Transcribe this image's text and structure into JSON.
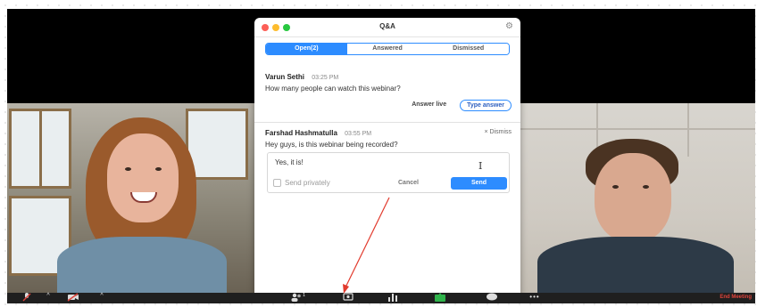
{
  "qa_window": {
    "title": "Q&A",
    "tabs": [
      {
        "label": "Open(2)",
        "active": true
      },
      {
        "label": "Answered",
        "active": false
      },
      {
        "label": "Dismissed",
        "active": false
      }
    ],
    "questions": [
      {
        "name": "Varun Sethi",
        "time": "03:25 PM",
        "text": "How many people can watch this webinar?",
        "answer_live_label": "Answer live",
        "type_answer_label": "Type answer"
      },
      {
        "name": "Farshad Hashmatulla",
        "time": "03:55 PM",
        "text": "Hey guys, is this webinar being recorded?",
        "dismiss_label": "× Dismiss",
        "reply_text": "Yes, it is!",
        "send_privately_label": "Send privately",
        "cancel_label": "Cancel",
        "send_label": "Send"
      }
    ]
  },
  "toolbar": {
    "participants_count": "1",
    "end_label": "End Meeting"
  },
  "colors": {
    "accent": "#2d8cff",
    "end": "#e0433b",
    "arrow": "#e23b2e",
    "toolbar_bg": "#1f1f1f"
  }
}
